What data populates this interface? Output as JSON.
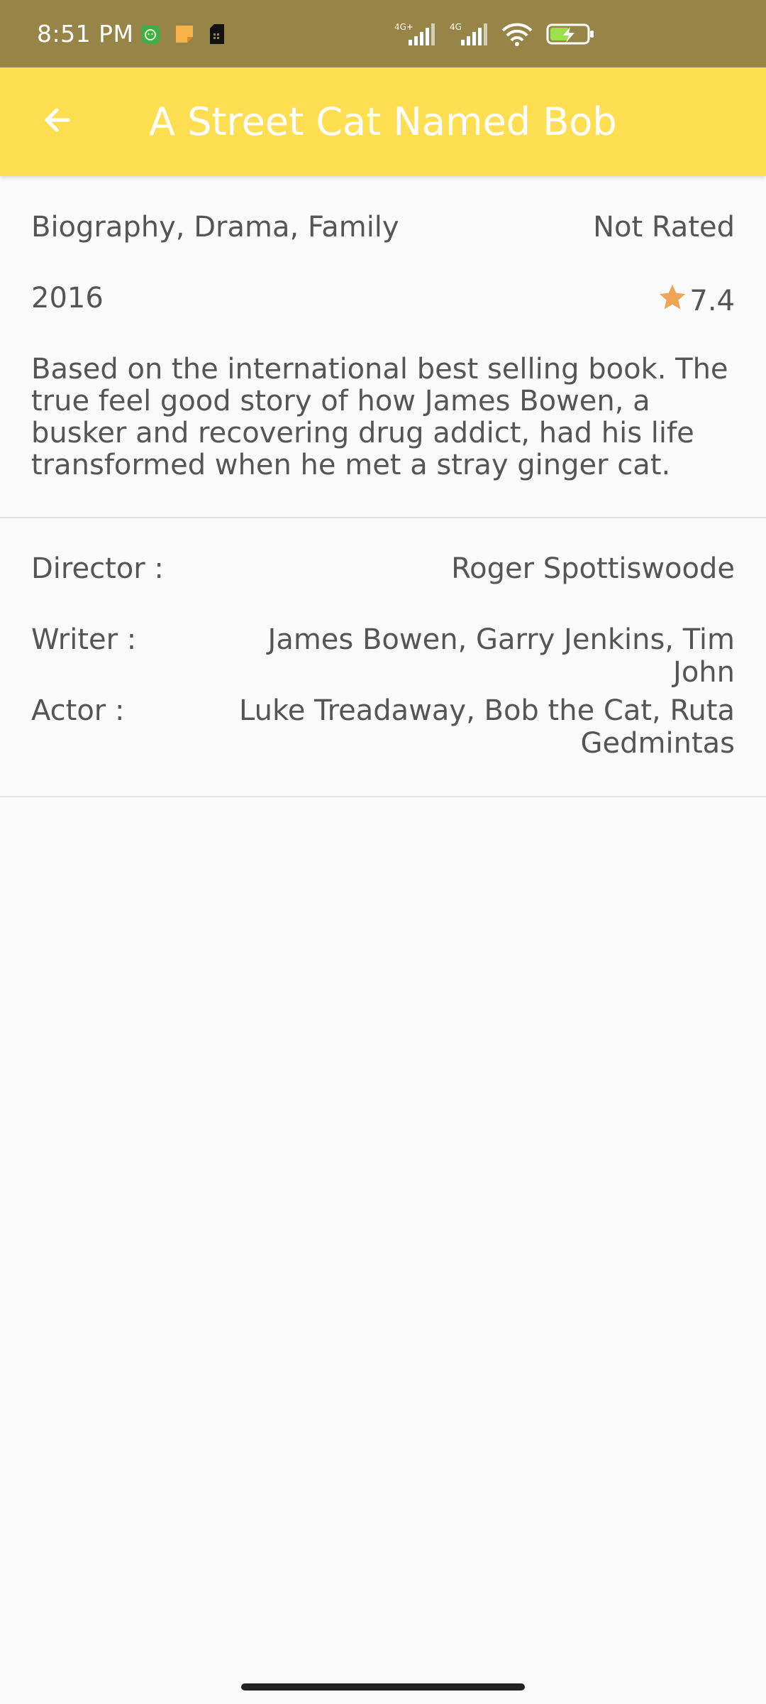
{
  "status_bar": {
    "time": "8:51 PM",
    "notification_icons": [
      "cat-app-icon",
      "note-icon",
      "sim-card-icon"
    ],
    "signal_icons": [
      "signal-4g-plus-icon",
      "signal-4g-icon",
      "wifi-icon",
      "battery-charging-icon"
    ],
    "net_label_1": "4G+",
    "net_label_2": "4G"
  },
  "app_bar": {
    "back_icon": "arrow-back-icon",
    "title": "A Street Cat Named Bob",
    "color": "#ffde52"
  },
  "movie": {
    "genres": "Biography, Drama, Family",
    "rated": "Not Rated",
    "year": "2016",
    "rating": "7.4",
    "rating_icon": "star-icon",
    "star_color": "#f0a556",
    "plot": "Based on the international best selling book. The true feel good story of how James Bowen, a busker and recovering drug addict, had his life transformed when he met a stray ginger cat."
  },
  "crew": {
    "director_label": "Director :",
    "director": "Roger Spottiswoode",
    "writer_label": "Writer :",
    "writer": "James Bowen, Garry Jenkins, Tim John",
    "actor_label": "Actor :",
    "actors": "Luke Treadaway, Bob the Cat, Ruta Gedmintas"
  }
}
